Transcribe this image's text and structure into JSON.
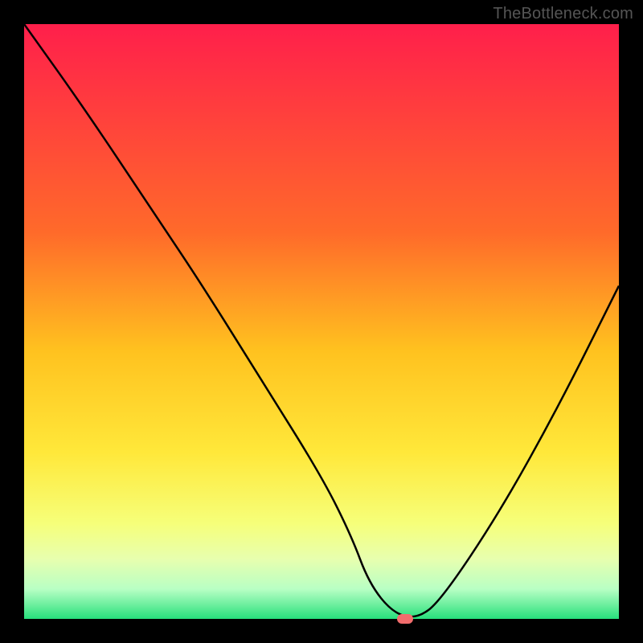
{
  "watermark": "TheBottleneck.com",
  "chart_data": {
    "type": "line",
    "title": "",
    "xlabel": "",
    "ylabel": "",
    "xlim": [
      0,
      100
    ],
    "ylim": [
      0,
      100
    ],
    "grid": false,
    "gradient_stops": [
      {
        "offset": 0,
        "color": "#ff1f4b"
      },
      {
        "offset": 35,
        "color": "#ff6a2a"
      },
      {
        "offset": 55,
        "color": "#ffc21f"
      },
      {
        "offset": 72,
        "color": "#ffe83a"
      },
      {
        "offset": 84,
        "color": "#f6ff7a"
      },
      {
        "offset": 90,
        "color": "#e7ffaf"
      },
      {
        "offset": 95,
        "color": "#b8ffc4"
      },
      {
        "offset": 100,
        "color": "#27e07c"
      }
    ],
    "series": [
      {
        "name": "bottleneck-curve",
        "x": [
          0,
          10,
          22,
          30,
          40,
          50,
          55,
          58,
          62,
          66,
          70,
          80,
          90,
          100
        ],
        "values": [
          100,
          86,
          68,
          56,
          40,
          24,
          14,
          6,
          1,
          0,
          3,
          18,
          36,
          56
        ]
      }
    ],
    "marker": {
      "x": 64,
      "y": 0
    },
    "colors": {
      "curve": "#000000",
      "marker": "#f26d6d",
      "background_frame": "#000000"
    }
  }
}
